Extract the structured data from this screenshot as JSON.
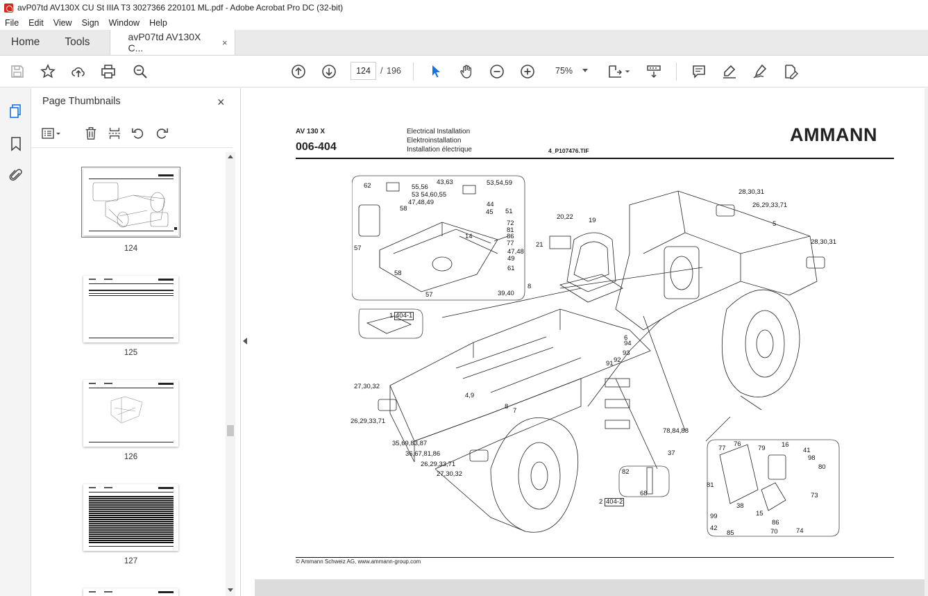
{
  "window": {
    "title": "avP07td AV130X CU St IIIA T3 3027366 220101 ML.pdf - Adobe Acrobat Pro DC (32-bit)"
  },
  "menu": [
    "File",
    "Edit",
    "View",
    "Sign",
    "Window",
    "Help"
  ],
  "tabs": {
    "home": "Home",
    "tools": "Tools",
    "document": "avP07td AV130X C...",
    "close": "×"
  },
  "toolbar": {
    "current_page": "124",
    "separator": "/",
    "total_pages": "196",
    "zoom": "75%"
  },
  "thumbnails_pane": {
    "title": "Page Thumbnails",
    "close": "×",
    "pages": [
      {
        "label": "124",
        "selected": true
      },
      {
        "label": "125",
        "selected": false
      },
      {
        "label": "126",
        "selected": false
      },
      {
        "label": "127",
        "selected": false
      }
    ]
  },
  "document": {
    "model": "AV 130 X",
    "code": "006-404",
    "section_en": "Electrical Installation",
    "section_de": "Elektroinstallation",
    "section_fr": "Installation électrique",
    "file_name": "4_P107476.TIF",
    "brand": "AMMANN",
    "footer": "© Ammann Schweiz AG, www.ammann-group.com",
    "callouts": [
      "62",
      "55,56",
      "53 54,60,55",
      "47,48,49",
      "58",
      "57",
      "43,63",
      "53,54,59",
      "44",
      "45",
      "51",
      "72",
      "81",
      "86",
      "14",
      "77",
      "47,48",
      "49",
      "61",
      "58",
      "57",
      "20,22",
      "19",
      "21",
      "8",
      "39,40",
      "1",
      "404-1",
      "28,30,31",
      "26,29,33,71",
      "5",
      "28,30,31",
      "6",
      "94",
      "93",
      "92",
      "91",
      "4,9",
      "27,30,32",
      "26,29,33,71",
      "8",
      "7",
      "35,69,83,87",
      "36,67,81,86",
      "26,29,33,71",
      "27,30,32",
      "78,84,88",
      "37",
      "82",
      "68",
      "2",
      "404-2",
      "77",
      "76",
      "79",
      "16",
      "41",
      "98",
      "80",
      "81",
      "73",
      "38",
      "15",
      "99",
      "42",
      "85",
      "70",
      "86",
      "74"
    ]
  }
}
